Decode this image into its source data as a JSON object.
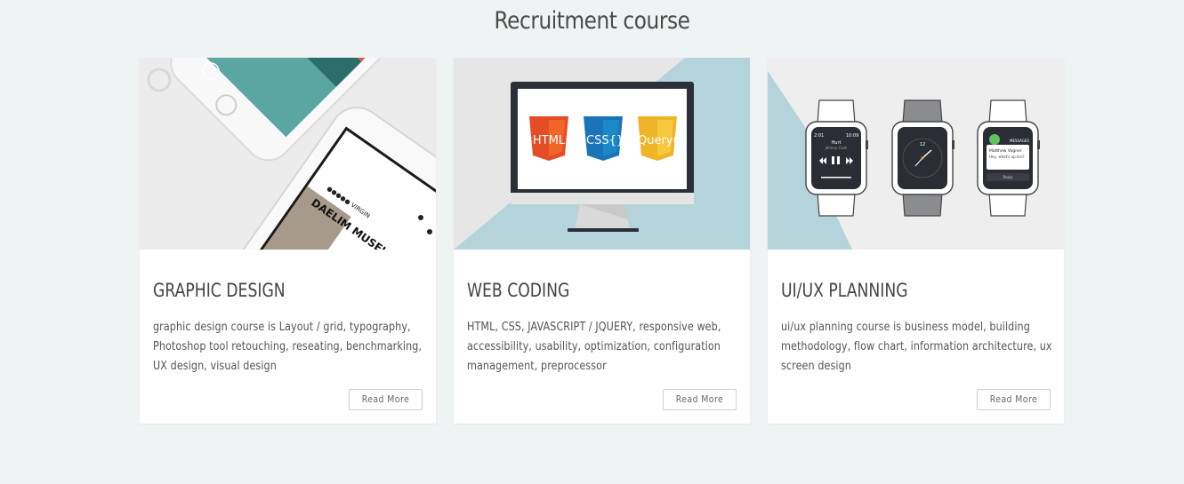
{
  "section": {
    "title": "Recruitment course"
  },
  "cards": [
    {
      "title": "GRAPHIC DESIGN",
      "description": "graphic design course is Layout / grid, typography, Photoshop tool retouching, reseating, benchmarking, UX design, visual design",
      "button_label": "Read More",
      "image_texts": {
        "carrier": "●●●●● VIRGIN",
        "brand": "DAELIM MUSEI"
      }
    },
    {
      "title": "WEB CODING",
      "description": "HTML, CSS, JAVASCRIPT / JQUERY, responsive web, accessibility, usability, optimization, configuration management, preprocessor",
      "button_label": "Read More",
      "image_texts": {
        "badge_html": "<HTML>",
        "badge_css": ".CSS{}",
        "badge_jquery": "jQuery()"
      }
    },
    {
      "title": "UI/UX PLANNING",
      "description": "ui/ux planning course is business model, building methodology, flow chart, information architecture, ux screen design",
      "button_label": "Read More",
      "image_texts": {
        "watch1_time_left": "2:01",
        "watch1_time_right": "10:09",
        "watch1_song": "Hurt",
        "watch1_artist": "Johnny Cash",
        "watch2_hour": "12",
        "watch3_header": "MESSAGES",
        "watch3_time": "10:09",
        "watch3_sender": "Matthew Vagner",
        "watch3_msg": "Hey, what's up bro?",
        "watch3_reply": "Reply"
      }
    }
  ],
  "colors": {
    "page_bg": "#f0f3f4",
    "card_bg": "#ffffff",
    "accent_teal": "#b5d3da",
    "html_orange": "#f26522",
    "css_blue": "#1fa0dc",
    "jquery_yellow": "#f5c518"
  }
}
